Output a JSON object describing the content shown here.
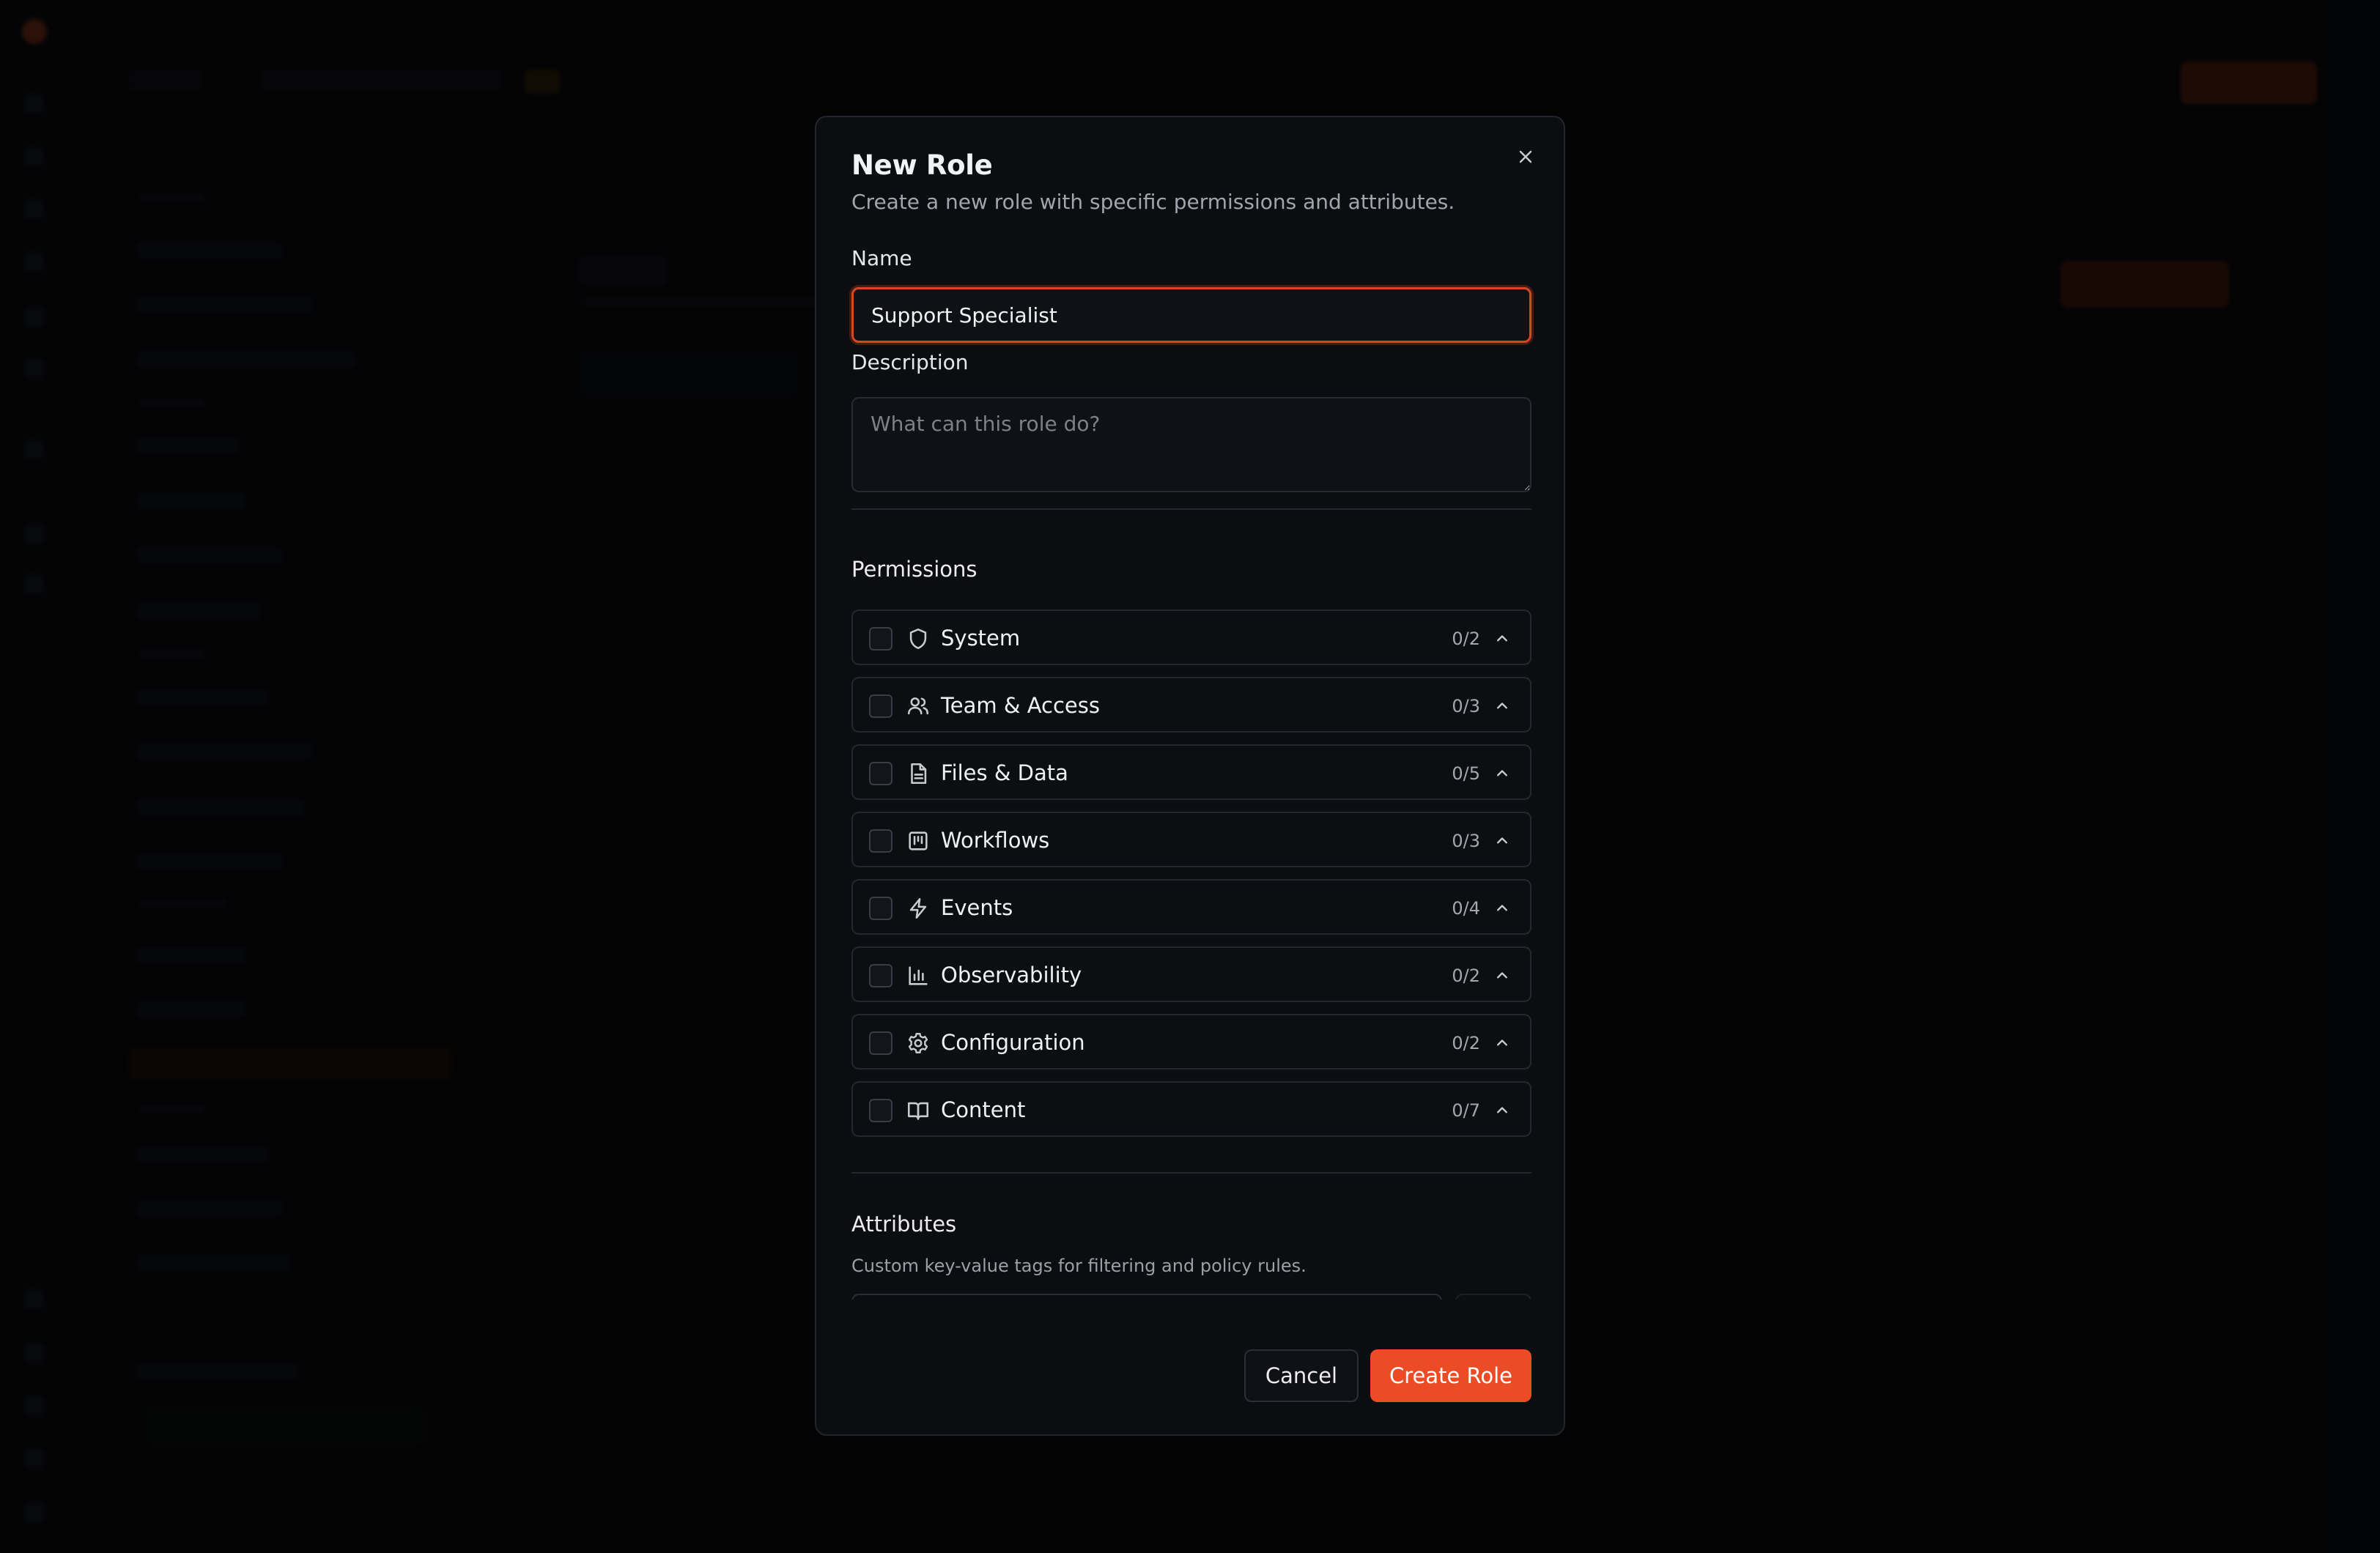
{
  "modal": {
    "title": "New Role",
    "subtitle": "Create a new role with specific permissions and attributes.",
    "close_icon": "close-icon"
  },
  "form": {
    "name_label": "Name",
    "name_value": "Support Specialist",
    "description_label": "Description",
    "description_placeholder": "What can this role do?",
    "description_value": ""
  },
  "permissions": {
    "title": "Permissions",
    "groups": [
      {
        "label": "System",
        "count": "0/2",
        "icon": "shield-icon"
      },
      {
        "label": "Team & Access",
        "count": "0/3",
        "icon": "users-icon"
      },
      {
        "label": "Files & Data",
        "count": "0/5",
        "icon": "file-icon"
      },
      {
        "label": "Workflows",
        "count": "0/3",
        "icon": "kanban-icon"
      },
      {
        "label": "Events",
        "count": "0/4",
        "icon": "lightning-icon"
      },
      {
        "label": "Observability",
        "count": "0/2",
        "icon": "bar-chart-icon"
      },
      {
        "label": "Configuration",
        "count": "0/2",
        "icon": "gear-icon"
      },
      {
        "label": "Content",
        "count": "0/7",
        "icon": "book-icon"
      }
    ]
  },
  "attributes": {
    "title": "Attributes",
    "subtitle": "Custom key-value tags for filtering and policy rules."
  },
  "footer": {
    "cancel_label": "Cancel",
    "create_label": "Create Role"
  },
  "colors": {
    "accent": "#ec4c25",
    "modal_bg": "#0c0d11",
    "border": "#25272e"
  }
}
